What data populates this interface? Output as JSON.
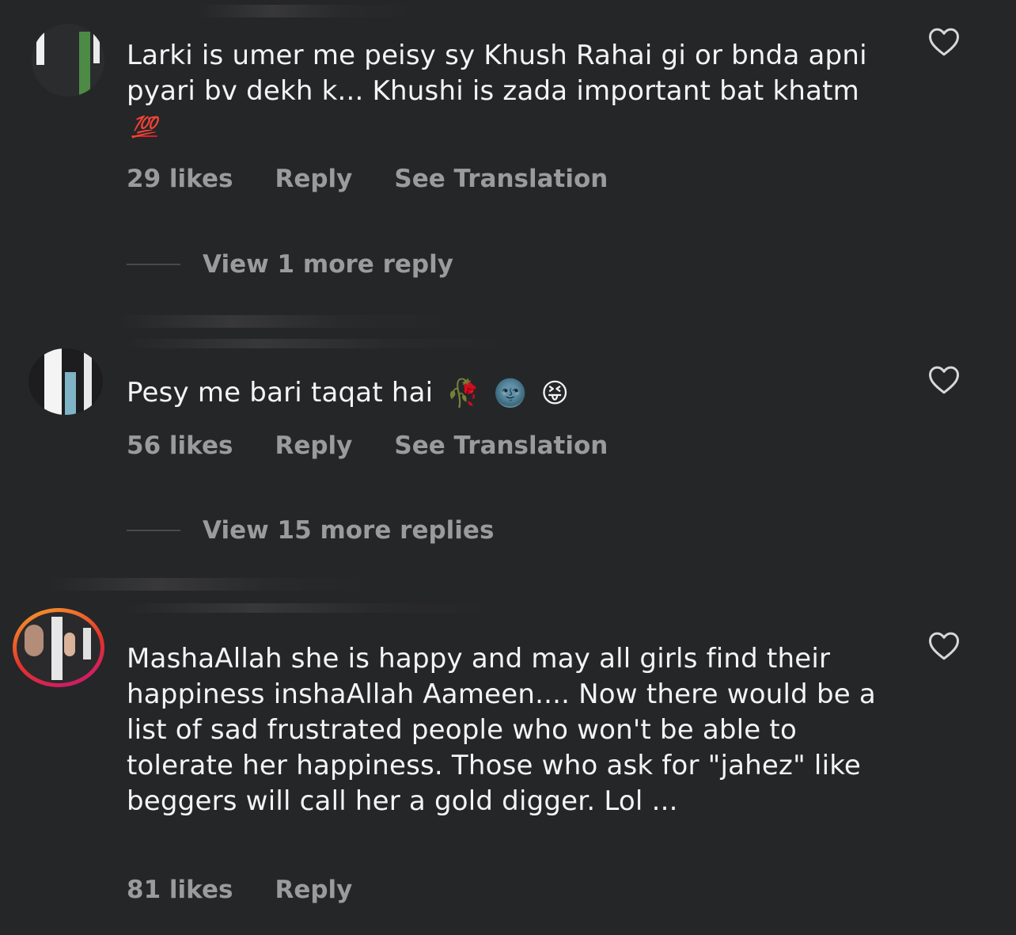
{
  "comments": [
    {
      "text": "Larki is umer me peisy sy Khush Rahai gi or bnda apni pyari bv dekh k... Khushi is zada important bat khatm",
      "emoji": "💯",
      "likes": "29 likes",
      "reply_label": "Reply",
      "translate_label": "See Translation",
      "view_replies": "View 1 more reply"
    },
    {
      "text": "Pesy me bari taqat hai",
      "emoji_rose": "🥀",
      "emoji_moon": "🌚",
      "emoji_face": "😝",
      "likes": "56 likes",
      "reply_label": "Reply",
      "translate_label": "See Translation",
      "view_replies": "View 15 more replies"
    },
    {
      "text": "MashaAllah she is happy and may all girls find their happiness inshaAllah Aameen.... Now there would be a list of sad frustrated people who won't be able to tolerate her happiness. Those who ask for \"jahez\" like beggers will call her a gold digger. Lol ...",
      "likes": "81 likes",
      "reply_label": "Reply"
    }
  ],
  "icons": {
    "like": "heart-outline-icon"
  },
  "colors": {
    "background": "#252628",
    "text": "#f4f4f4",
    "meta": "#9b9b9d",
    "hundred": "#d8202a"
  }
}
